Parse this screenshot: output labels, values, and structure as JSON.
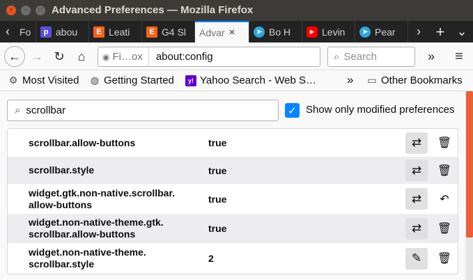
{
  "window": {
    "title": "Advanced Preferences — Mozilla Firefox",
    "close_glyph": "×",
    "min_glyph": "–",
    "max_glyph": "□"
  },
  "tabs": [
    {
      "label": "Fo",
      "icon": "generic-page-icon",
      "color": "#555555",
      "glyph": ""
    },
    {
      "label": "abou",
      "icon": "purple-p-icon",
      "color": "#5b4fd6",
      "glyph": "p"
    },
    {
      "label": "Leati",
      "icon": "etsy-icon",
      "color": "#f1641e",
      "glyph": "E"
    },
    {
      "label": "G4 Sl",
      "icon": "etsy-icon",
      "color": "#f1641e",
      "glyph": "E"
    },
    {
      "label": "Advar",
      "icon": "firefox-icon",
      "color": "#ff9500",
      "glyph": "",
      "active": true,
      "close": "×"
    },
    {
      "label": "Bo H",
      "icon": "telegram-icon",
      "color": "#2ea6df",
      "glyph": "➤"
    },
    {
      "label": "Levin",
      "icon": "youtube-icon",
      "color": "#ff0000",
      "glyph": "▶"
    },
    {
      "label": "Pear",
      "icon": "telegram-icon",
      "color": "#2ea6df",
      "glyph": "➤"
    }
  ],
  "tabstrip": {
    "scroll_left": "‹",
    "scroll_right": "›",
    "new_tab": "+",
    "list_all": "⌄"
  },
  "nav": {
    "back": "←",
    "forward": "→",
    "reload": "↻",
    "home": "⌂",
    "identity_label": "Fi…ox",
    "identity_icon": "firefox-identity-icon",
    "url": "about:config",
    "search_placeholder": "Search",
    "search_glyph": "⌕",
    "overflow": "»",
    "menu": "≡"
  },
  "bookmarks": [
    {
      "label": "Most Visited",
      "icon": "gear-icon",
      "glyph": "⚙"
    },
    {
      "label": "Getting Started",
      "icon": "globe-icon",
      "glyph": "◍"
    },
    {
      "label": "Yahoo Search - Web S…",
      "icon": "yahoo-icon",
      "glyph": "y!"
    }
  ],
  "bookmarks_overflow": "»",
  "other_bookmarks": {
    "label": "Other Bookmarks",
    "icon": "folder-icon",
    "glyph": "▭"
  },
  "filter": {
    "value": "scrollbar",
    "glyph": "⌕"
  },
  "modified_only": {
    "label": "Show only modified preferences",
    "checked": true,
    "glyph": "✓"
  },
  "prefs": [
    {
      "name": "scrollbar.allow-buttons",
      "value": "true",
      "action": "toggle",
      "action_glyph": "⇄",
      "secondary": "delete",
      "secondary_glyph": "🗑"
    },
    {
      "name": "scrollbar.style",
      "value": "true",
      "action": "toggle",
      "action_glyph": "⇄",
      "secondary": "delete",
      "secondary_glyph": "🗑"
    },
    {
      "name": "widget.gtk.non-native.scrollbar.\nallow-buttons",
      "value": "true",
      "action": "toggle",
      "action_glyph": "⇄",
      "secondary": "reset",
      "secondary_glyph": "↶"
    },
    {
      "name": "widget.non-native-theme.gtk.\nscrollbar.allow-buttons",
      "value": "true",
      "action": "toggle",
      "action_glyph": "⇄",
      "secondary": "delete",
      "secondary_glyph": "🗑"
    },
    {
      "name": "widget.non-native-theme.\nscrollbar.style",
      "value": "2",
      "action": "edit",
      "action_glyph": "✎",
      "secondary": "delete",
      "secondary_glyph": "🗑"
    }
  ],
  "colors": {
    "accent": "#0a84ff",
    "titlebar": "#3c3b37",
    "tabstrip": "#232323",
    "scroll_thumb": "#e95f3a"
  }
}
